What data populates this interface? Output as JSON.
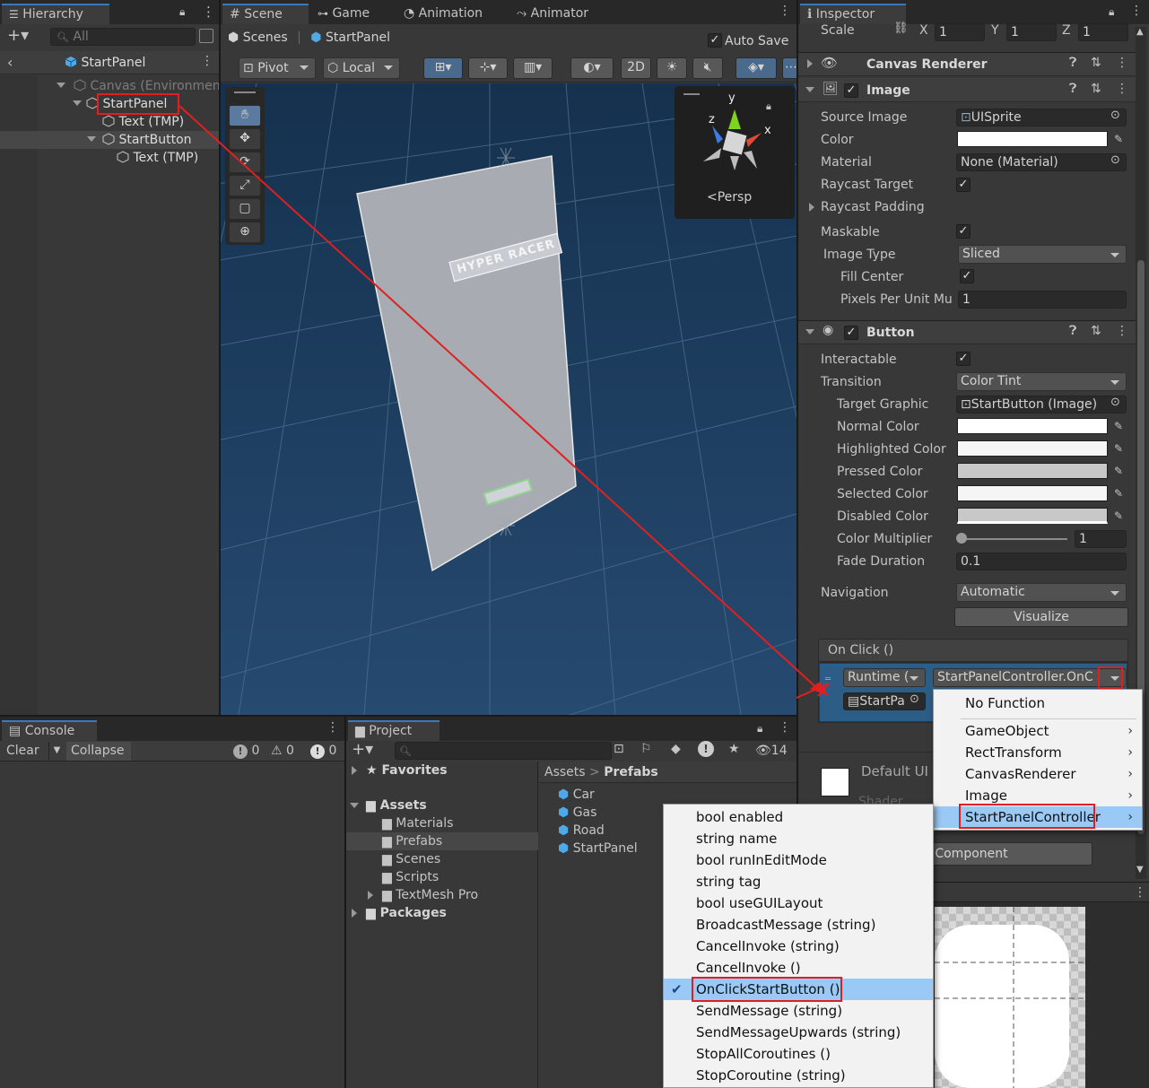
{
  "hierarchy": {
    "tab": "Hierarchy",
    "search": "All",
    "scene": "StartPanel",
    "items": [
      "Canvas (Environmen",
      "StartPanel",
      "Text (TMP)",
      "StartButton",
      "Text (TMP)"
    ]
  },
  "scene": {
    "tabs": [
      "Scene",
      "Game",
      "Animation",
      "Animator"
    ],
    "breadcrumb_root": "Scenes",
    "breadcrumb_current": "StartPanel",
    "autosave": "Auto Save",
    "pivot": "Pivot",
    "local": "Local",
    "btn_2d": "2D",
    "gizmo_label": "Persp",
    "gizmo_axes": {
      "y": "y",
      "z": "z",
      "x": "x"
    },
    "panel_title": "HYPER RACER"
  },
  "console": {
    "tab": "Console",
    "clear": "Clear",
    "collapse": "Collapse",
    "counts": [
      "0",
      "0",
      "0"
    ]
  },
  "project": {
    "tab": "Project",
    "count": "14",
    "tree": {
      "favorites": "Favorites",
      "assets": "Assets",
      "folders": [
        "Materials",
        "Prefabs",
        "Scenes",
        "Scripts",
        "TextMesh Pro"
      ],
      "packages": "Packages"
    },
    "path": [
      "Assets",
      "Prefabs"
    ],
    "files": [
      "Car",
      "Gas",
      "Road",
      "StartPanel"
    ]
  },
  "inspector": {
    "tab": "Inspector",
    "scale_label": "Scale",
    "scale": {
      "x_label": "X",
      "y_label": "Y",
      "z_label": "Z",
      "x": "1",
      "y": "1",
      "z": "1"
    },
    "canvas_renderer": "Canvas Renderer",
    "image": {
      "title": "Image",
      "rows": {
        "source_label": "Source Image",
        "source": "UISprite",
        "color_label": "Color",
        "material_label": "Material",
        "material": "None (Material)",
        "raycast_target": "Raycast Target",
        "raycast_padding": "Raycast Padding",
        "maskable": "Maskable",
        "image_type_label": "Image Type",
        "image_type": "Sliced",
        "fill_center": "Fill Center",
        "ppu_label": "Pixels Per Unit Mu",
        "ppu": "1"
      }
    },
    "button": {
      "title": "Button",
      "interactable": "Interactable",
      "transition_label": "Transition",
      "transition": "Color Tint",
      "target_label": "Target Graphic",
      "target": "StartButton (Image)",
      "normal": "Normal Color",
      "highlighted": "Highlighted Color",
      "pressed": "Pressed Color",
      "selected": "Selected Color",
      "disabled": "Disabled Color",
      "multiplier_label": "Color Multiplier",
      "multiplier": "1",
      "fade_label": "Fade Duration",
      "fade": "0.1",
      "nav_label": "Navigation",
      "nav": "Automatic",
      "visualize": "Visualize"
    },
    "onclick": {
      "title": "On Click ()",
      "runtime": "Runtime (",
      "function": "StartPanelController.OnC",
      "object": "StartPa"
    },
    "material_preview": {
      "name": "Default UI",
      "shader": "Shader",
      "add_component": "Component"
    }
  },
  "component_menu": [
    "No Function",
    "GameObject",
    "RectTransform",
    "CanvasRenderer",
    "Image",
    "StartPanelController"
  ],
  "function_menu": [
    "bool enabled",
    "string name",
    "bool runInEditMode",
    "string tag",
    "bool useGUILayout",
    "BroadcastMessage (string)",
    "CancelInvoke (string)",
    "CancelInvoke ()",
    "OnClickStartButton ()",
    "SendMessage (string)",
    "SendMessageUpwards (string)",
    "StopAllCoroutines ()",
    "StopCoroutine (string)"
  ],
  "colors": {
    "highlight": "#e02020",
    "selected_row": "#99c9f4",
    "scene_bg": "#1e3a5a",
    "accent": "#3a79bb"
  }
}
